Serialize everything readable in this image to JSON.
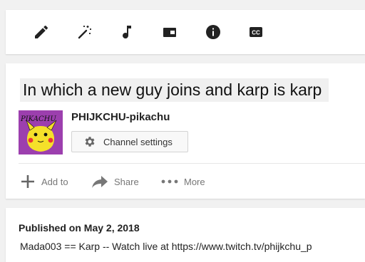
{
  "toolbar": {
    "tools": [
      {
        "name": "edit",
        "icon": "pencil-icon"
      },
      {
        "name": "enhancements",
        "icon": "magic-wand-icon"
      },
      {
        "name": "audio",
        "icon": "music-note-icon"
      },
      {
        "name": "end-screen",
        "icon": "card-icon"
      },
      {
        "name": "info",
        "icon": "info-icon"
      },
      {
        "name": "subtitles",
        "icon": "closed-captions-icon"
      }
    ],
    "cc_label": "CC"
  },
  "video": {
    "title": "In which a new guy joins and karp is karp"
  },
  "channel": {
    "name": "PHIJKCHU-pikachu",
    "avatar_text": "PIKACHU",
    "settings_label": "Channel settings",
    "avatar_color": "#9c3fae"
  },
  "actions": {
    "add_to": "Add to",
    "share": "Share",
    "more": "More"
  },
  "description": {
    "published": "Published on May 2, 2018",
    "text": "Mada003 == Karp -- Watch live at https://www.twitch.tv/phijkchu_p"
  }
}
